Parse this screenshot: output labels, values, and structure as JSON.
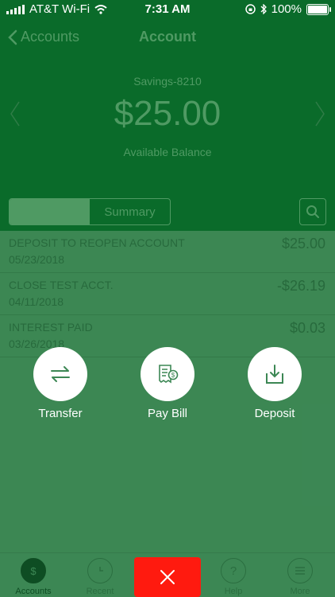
{
  "status_bar": {
    "carrier": "AT&T Wi-Fi",
    "time": "7:31 AM",
    "battery": "100%",
    "battery_level": 1.0
  },
  "nav": {
    "back_label": "Accounts",
    "title": "Account"
  },
  "account": {
    "name": "Savings-8210",
    "balance": "$25.00",
    "balance_label": "Available Balance"
  },
  "segments": {
    "first_label": "",
    "summary_label": "Summary"
  },
  "transactions": [
    {
      "description": "DEPOSIT TO REOPEN ACCOUNT",
      "date": "05/23/2018",
      "amount": "$25.00"
    },
    {
      "description": "CLOSE TEST ACCT.",
      "date": "04/11/2018",
      "amount": "-$26.19"
    },
    {
      "description": "INTEREST PAID",
      "date": "03/26/2018",
      "amount": "$0.03"
    }
  ],
  "actions": {
    "transfer": "Transfer",
    "pay_bill": "Pay Bill",
    "deposit": "Deposit"
  },
  "tabbar": {
    "accounts": "Accounts",
    "recent": "Recent",
    "help": "Help",
    "more": "More"
  },
  "colors": {
    "header_bg": "#0a6b2a",
    "body_bg": "#3c8754",
    "close_button": "#ff1a0f"
  }
}
